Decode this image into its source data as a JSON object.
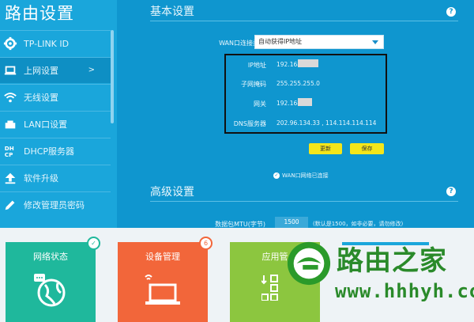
{
  "app": {
    "title": "路由设置"
  },
  "sidebar": {
    "items": [
      {
        "label": "TP-LINK ID",
        "icon": "gear-icon"
      },
      {
        "label": "上网设置",
        "icon": "laptop-icon",
        "arrow": ">"
      },
      {
        "label": "无线设置",
        "icon": "wifi-icon"
      },
      {
        "label": "LAN口设置",
        "icon": "lan-icon"
      },
      {
        "label": "DHCP服务器",
        "icon": "dhcp-icon"
      },
      {
        "label": "软件升级",
        "icon": "upload-icon"
      },
      {
        "label": "修改管理员密码",
        "icon": "pencil-icon"
      }
    ]
  },
  "basic": {
    "title": "基本设置",
    "help": "?",
    "wan_type_label": "WAN口连接类型",
    "wan_type_value": "自动获得IP地址",
    "ip_label": "IP地址",
    "ip_value": "192.168.",
    "mask_label": "子网掩码",
    "mask_value": "255.255.255.0",
    "gw_label": "网关",
    "gw_value": "192.168.",
    "dns_label": "DNS服务器",
    "dns_value": "202.96.134.33 , 114.114.114.114",
    "refresh_button": "更新",
    "save_button": "保存",
    "status_text": "WAN口网络已连接"
  },
  "advanced": {
    "title": "高级设置",
    "help": "?",
    "mtu_label": "数据包MTU(字节)",
    "mtu_value": "1500",
    "mtu_hint": "(默认是1500，如非必要，请勿修改)"
  },
  "tiles": [
    {
      "title": "网络状态",
      "color": "#1fb89c",
      "badge": "✓"
    },
    {
      "title": "设备管理",
      "color": "#f2663a",
      "badge": "6"
    },
    {
      "title": "应用管",
      "color": "#8cc63f"
    }
  ],
  "watermark": {
    "text": "路由之家",
    "url": "www.hhhyh.com"
  }
}
